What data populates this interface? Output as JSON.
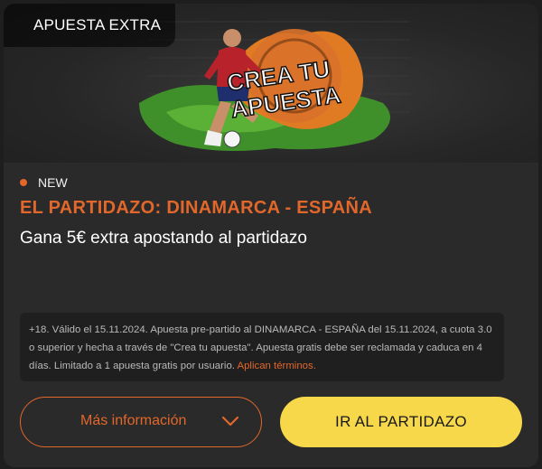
{
  "tag": "APUESTA EXTRA",
  "banner": {
    "logo_line1": "CREA TU",
    "logo_line2": "APUESTA"
  },
  "badge": "NEW",
  "title": "EL PARTIDAZO: DINAMARCA - ESPAÑA",
  "subtitle": "Gana 5€ extra apostando al partidazo",
  "terms": {
    "text": "+18. Válido el 15.11.2024. Apuesta pre-partido al DINAMARCA - ESPAÑA del 15.11.2024, a cuota 3.0 o superior y hecha a través de \"Crea tu apuesta\". Apuesta gratis debe ser reclamada y caduca en 4 días. Limitado a 1 apuesta gratis por usuario.",
    "link": "Aplican términos."
  },
  "buttons": {
    "more_info": "Más información",
    "go": "IR AL PARTIDAZO"
  },
  "icons": {
    "more_info": "chevron-down-icon",
    "badge": "dot-icon",
    "player": "football-player-icon"
  },
  "colors": {
    "accent": "#e2672b",
    "yellow": "#f6d84a",
    "background": "#2a2a2a"
  }
}
